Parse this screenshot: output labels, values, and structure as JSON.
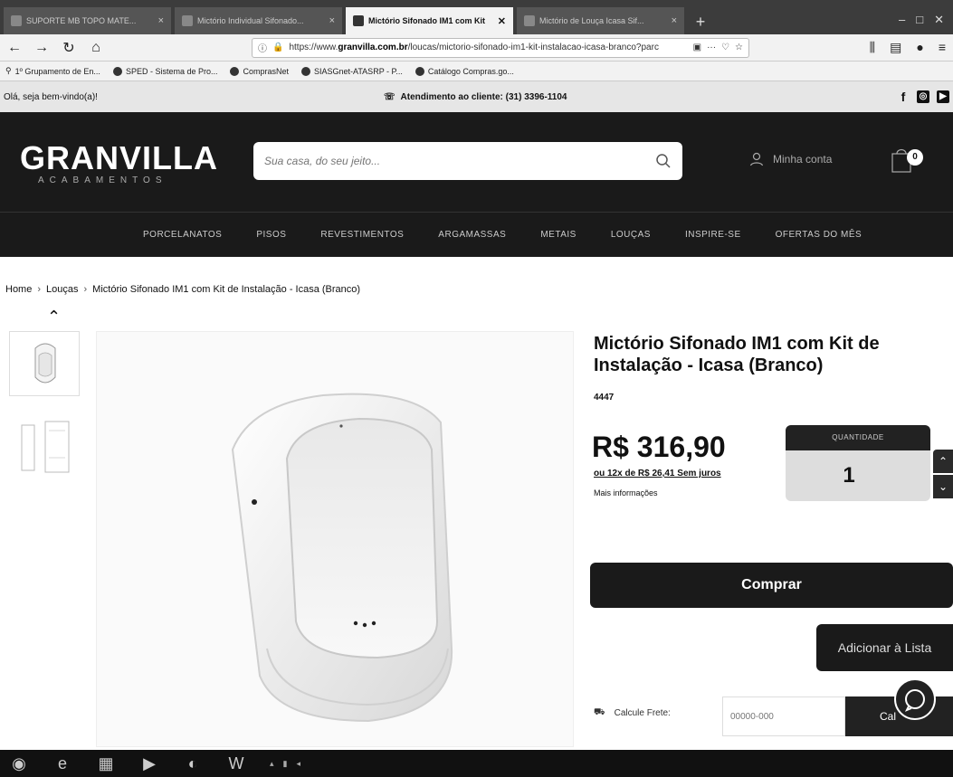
{
  "browser": {
    "tabs": [
      {
        "title": "SUPORTE MB TOPO MATE...",
        "active": false
      },
      {
        "title": "Mictório Individual Sifonado...",
        "active": false
      },
      {
        "title": "Mictório Sifonado IM1 com Kit",
        "active": true
      },
      {
        "title": "Mictório de Louça Icasa Sif...",
        "active": false
      }
    ],
    "url_prefix": "https://www.",
    "url_domain": "granvilla.com.br",
    "url_path": "/loucas/mictorio-sifonado-im1-kit-instalacao-icasa-branco?parc",
    "bookmarks": [
      "1º Grupamento de En...",
      "SPED - Sistema de Pro...",
      "ComprasNet",
      "SIASGnet-ATASRP - P...",
      "Catálogo Compras.go..."
    ]
  },
  "site": {
    "welcome": "Olá, seja bem-vindo(a)!",
    "phone": "Atendimento ao cliente: (31) 3396-1104",
    "logo_name": "GRANVILLA",
    "logo_sub": "ACABAMENTOS",
    "search_placeholder": "Sua casa, do seu jeito...",
    "account_label": "Minha conta",
    "cart_count": "0",
    "menu": [
      "PORCELANATOS",
      "PISOS",
      "REVESTIMENTOS",
      "ARGAMASSAS",
      "METAIS",
      "LOUÇAS",
      "INSPIRE-SE",
      "OFERTAS DO MÊS"
    ]
  },
  "breadcrumb": {
    "home": "Home",
    "category": "Louças",
    "current": "Mictório Sifonado IM1 com Kit de Instalação - Icasa (Branco)"
  },
  "product": {
    "title": "Mictório Sifonado IM1 com Kit de Instalação - Icasa (Branco)",
    "sku": "4447",
    "price": "R$ 316,90",
    "installment": "ou 12x de R$ 26,41 Sem juros",
    "more_info": "Mais informações",
    "qty_label": "QUANTIDADE",
    "qty_value": "1",
    "buy_label": "Comprar",
    "add_list_label": "Adicionar à Lista",
    "frete_label": "Calcule Frete:",
    "cep_placeholder": "00000-000",
    "calc_label": "Cal"
  },
  "colors": {
    "header_bg": "#1a1a1a",
    "button_bg": "#1a1a1a",
    "text": "#111111"
  }
}
